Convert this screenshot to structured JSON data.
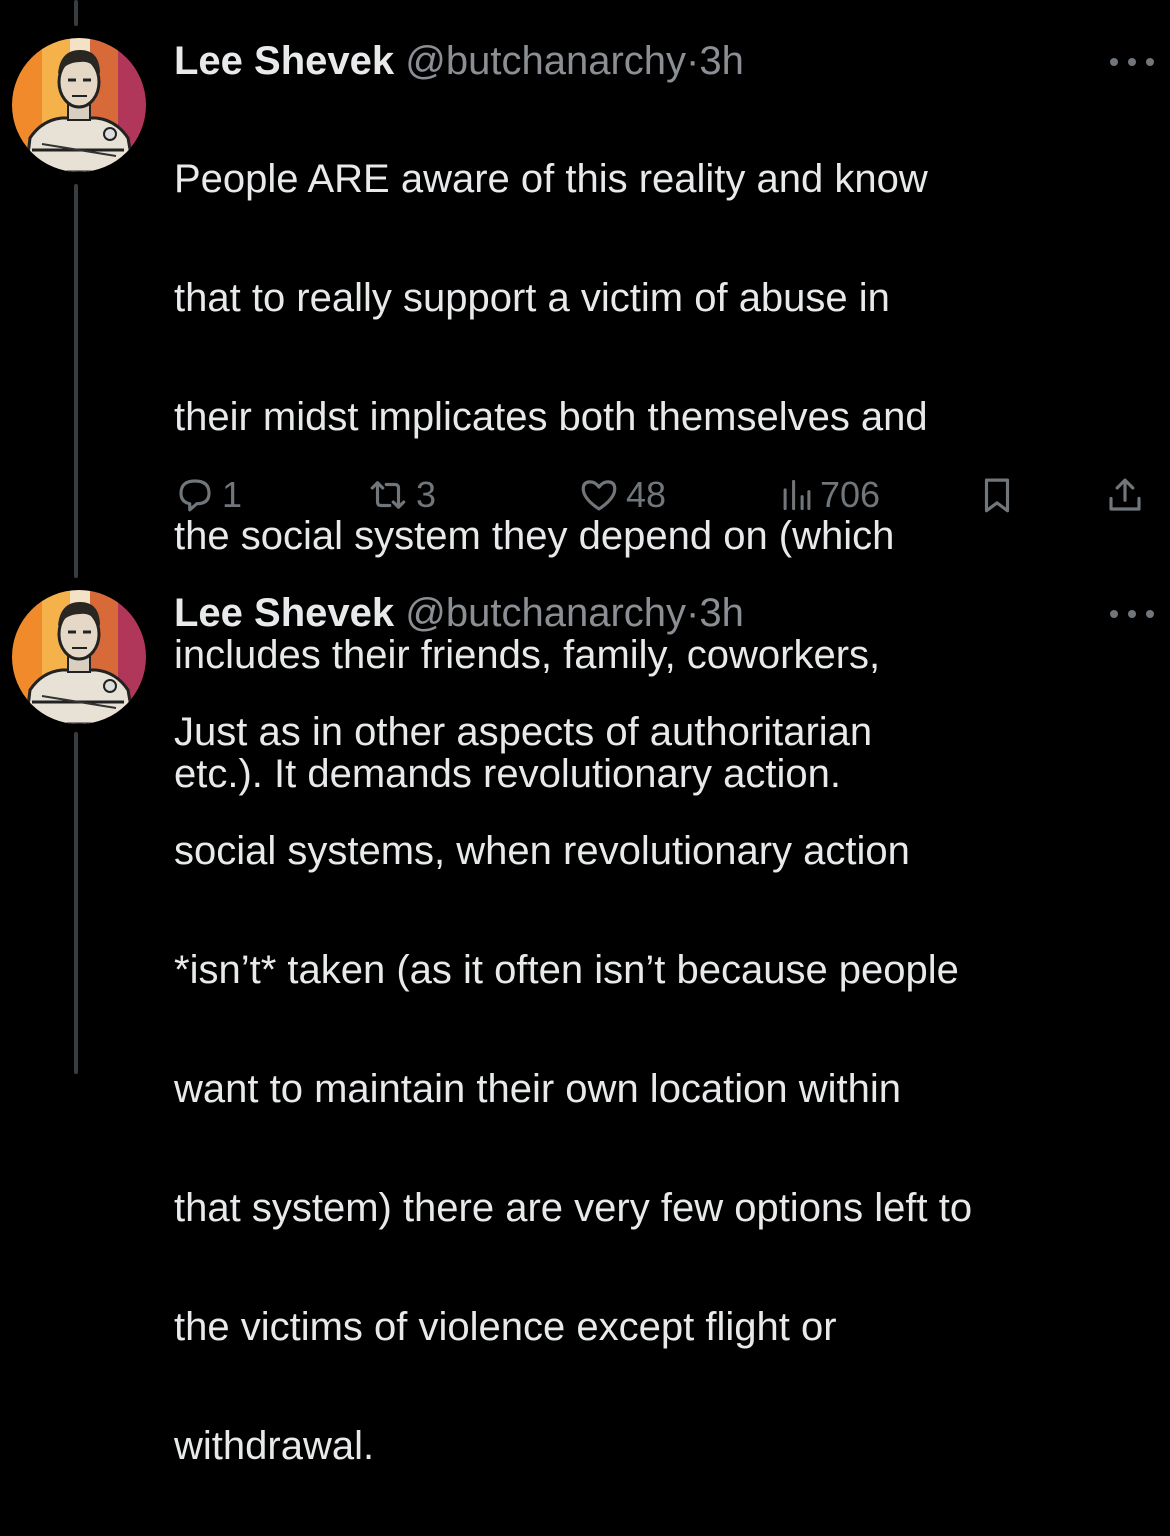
{
  "tweets": [
    {
      "display_name": "Lee Shevek",
      "handle": "@butchanarchy",
      "separator": "·",
      "time": "3h",
      "lines": [
        "People ARE aware of this reality and know",
        "that to really support a victim of abuse in",
        "their midst implicates both themselves and",
        "the social system they depend on (which",
        "includes their friends, family, coworkers,",
        "etc.). It demands revolutionary action."
      ],
      "stats": {
        "replies": "1",
        "reposts": "3",
        "likes": "48",
        "views": "706"
      }
    },
    {
      "display_name": "Lee Shevek",
      "handle": "@butchanarchy",
      "separator": "·",
      "time": "3h",
      "lines": [
        "Just as in other aspects of authoritarian",
        "social systems, when revolutionary action",
        "*isn’t* taken (as it often isn’t because people",
        "want to maintain their own location within",
        "that system) there are very few options left to",
        "the victims of violence except flight or",
        "withdrawal."
      ]
    }
  ],
  "icons": {
    "reply": "reply-icon",
    "repost": "repost-icon",
    "like": "heart-icon",
    "views": "views-chart-icon",
    "bookmark": "bookmark-icon",
    "share": "share-icon",
    "more": "more-dots-icon"
  },
  "colors": {
    "background": "#000000",
    "text": "#e7e9ea",
    "secondary": "#8b8f94",
    "icon": "#71767b",
    "thread_line": "#3a3d40"
  }
}
